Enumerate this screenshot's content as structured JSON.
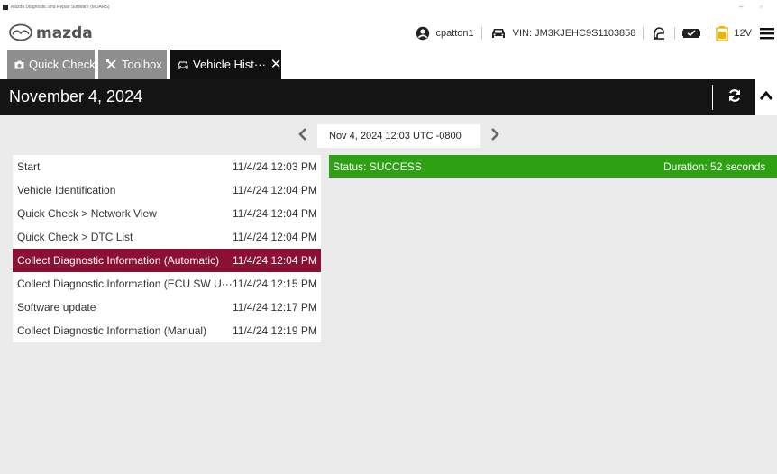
{
  "window": {
    "title": "Mazda Diagnostic and Repair Software (MDARS)",
    "minimize_glyph": "–",
    "restore_glyph": "▫"
  },
  "header": {
    "logo_text": "mazda",
    "user": "cpatton1",
    "vin": "VIN: JM3KJEHC9S1103858",
    "voltage": "12V",
    "icons": [
      "user-icon",
      "car-icon",
      "connection-icon",
      "vci-icon",
      "battery-icon",
      "menu-icon"
    ]
  },
  "tabs": [
    {
      "label": "Quick Check",
      "icon": "camera-icon",
      "active": false
    },
    {
      "label": "Toolbox",
      "icon": "tools-icon",
      "active": false
    },
    {
      "label": "Vehicle Hist···",
      "icon": "car-history-icon",
      "active": true,
      "close": "✕"
    }
  ],
  "datebar": {
    "title": "November 4, 2024",
    "icons": [
      "refresh-icon",
      "chevron-up-icon"
    ]
  },
  "navigator": {
    "current": "Nov 4, 2024 12:03 UTC -0800",
    "icons": [
      "chevron-left-icon",
      "chevron-right-icon"
    ]
  },
  "sessions": [
    {
      "name": "Start",
      "time": "11/4/24 12:03 PM"
    },
    {
      "name": "Vehicle Identification",
      "time": "11/4/24 12:04 PM"
    },
    {
      "name": "Quick Check > Network View",
      "time": "11/4/24 12:04 PM"
    },
    {
      "name": "Quick Check > DTC List",
      "time": "11/4/24 12:04 PM"
    },
    {
      "name": "Collect Diagnostic Information (Automatic)",
      "time": "11/4/24 12:04 PM",
      "selected": true
    },
    {
      "name": "Collect Diagnostic Information (ECU SW U···",
      "time": "11/4/24 12:15 PM"
    },
    {
      "name": "Software update",
      "time": "11/4/24 12:17 PM"
    },
    {
      "name": "Collect Diagnostic Information (Manual)",
      "time": "11/4/24 12:19 PM"
    }
  ],
  "status": {
    "label": "Status: SUCCESS",
    "duration": "Duration: 52 seconds",
    "color": "#2ea014"
  },
  "colors": {
    "selected_row": "#8c1034",
    "active_tab": "#111111",
    "inactive_tab": "#8e8e8e",
    "battery": "#f0b400"
  }
}
